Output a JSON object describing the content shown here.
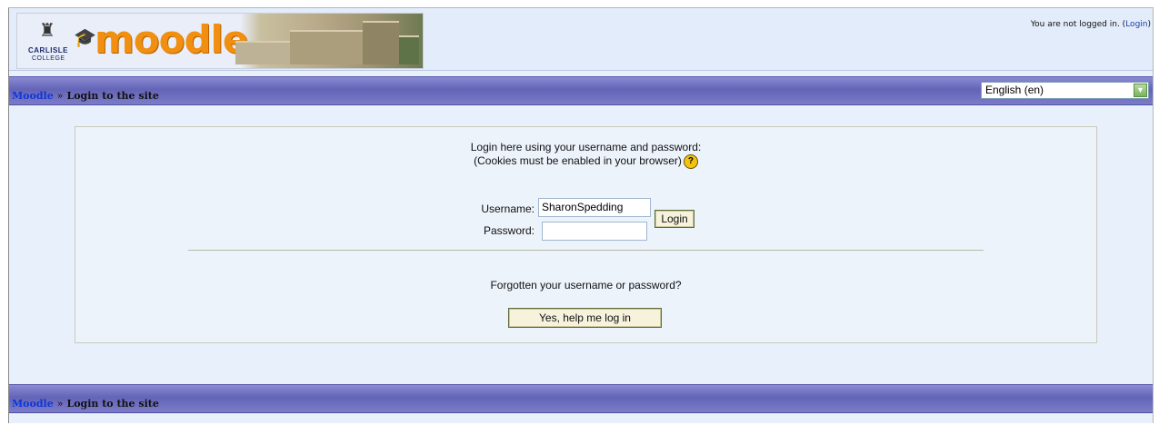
{
  "header": {
    "college_name_line1": "CARLISLE",
    "college_name_line2": "COLLEGE",
    "brand": "moodle",
    "status_text": "You are not logged in. (",
    "login_link": "Login",
    "status_close": ")"
  },
  "nav": {
    "home_link": "Moodle",
    "separator": "»",
    "current": "Login to the site"
  },
  "language": {
    "selected": "English (en)"
  },
  "login": {
    "intro_line1": "Login here using your username and password:",
    "intro_line2": "(Cookies must be enabled in your browser)",
    "help_icon": "?",
    "username_label": "Username:",
    "username_value": "SharonSpedding",
    "password_label": "Password:",
    "password_value": "",
    "login_button": "Login",
    "forgot_text": "Forgotten your username or password?",
    "help_button": "Yes, help me log in"
  },
  "colors": {
    "navbar": "#6464b8",
    "link": "#1036d6",
    "brand_orange": "#f08f10"
  }
}
